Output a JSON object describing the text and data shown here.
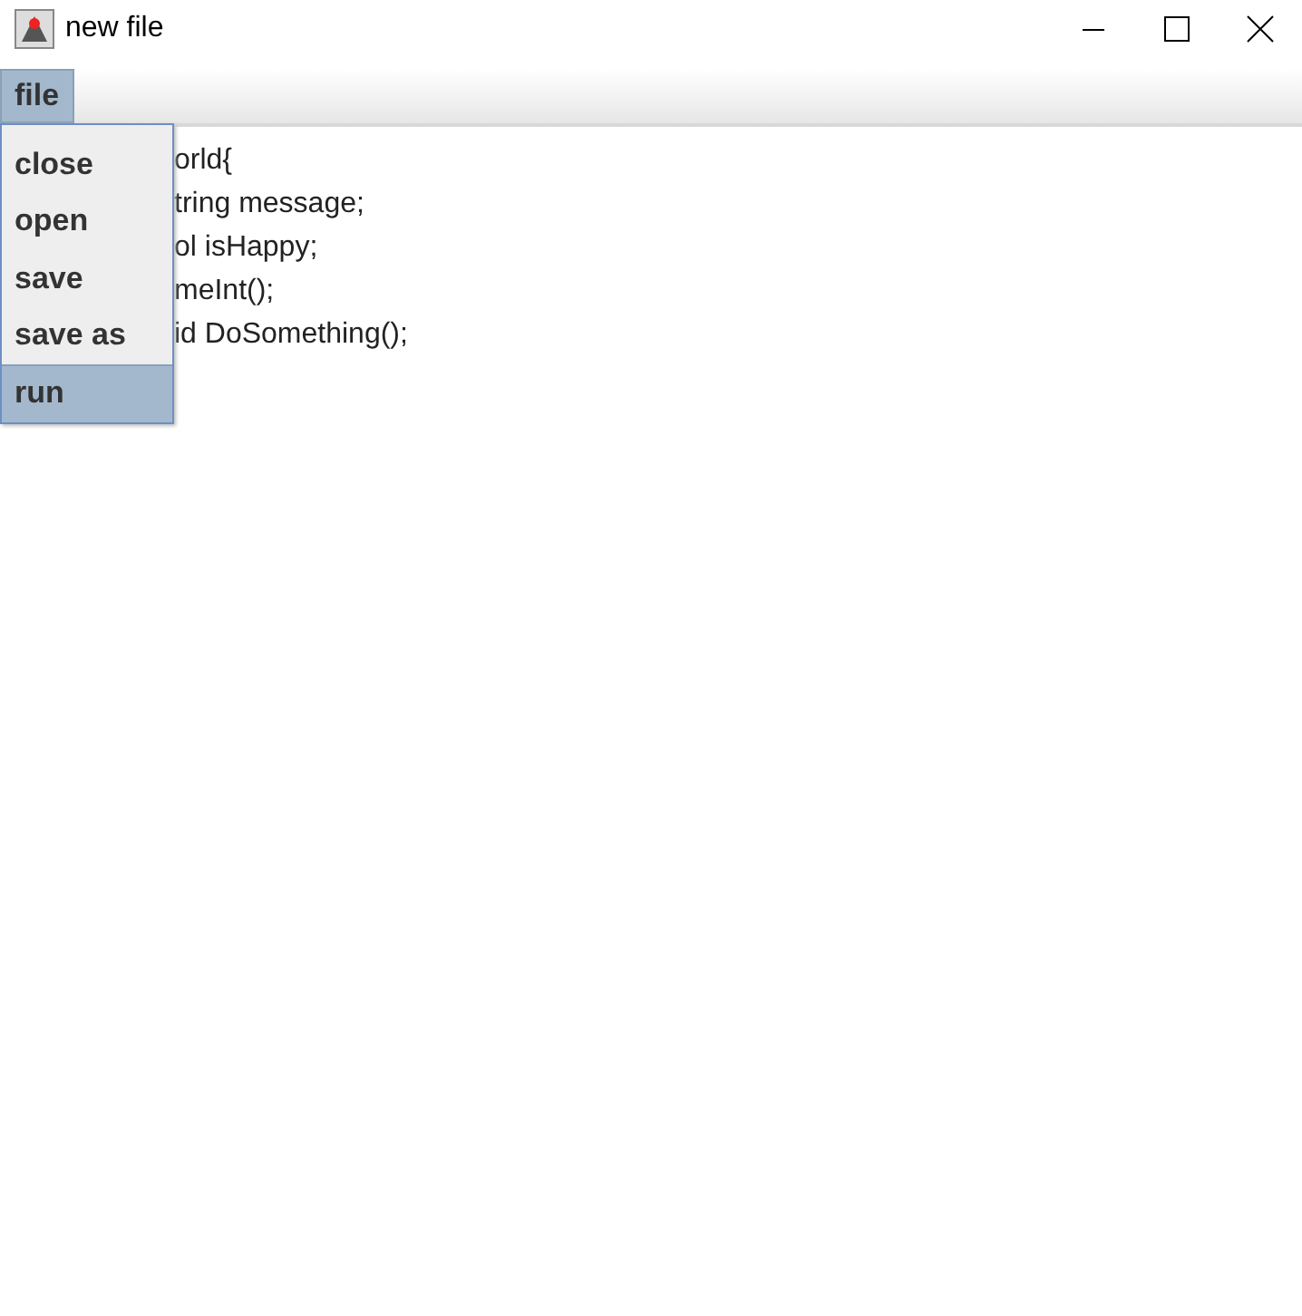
{
  "window": {
    "title": "new file"
  },
  "menu_bar": [
    {
      "label": "file",
      "selected": true
    }
  ],
  "dropdown": {
    "items": [
      {
        "label": "close",
        "selected": false
      },
      {
        "label": "open",
        "selected": false
      },
      {
        "label": "save",
        "selected": false
      },
      {
        "label": "save as",
        "selected": false
      },
      {
        "label": "run",
        "selected": true
      }
    ]
  },
  "editor": {
    "lines": [
      "orld{",
      "tring message;",
      "ol isHappy;",
      "meInt();",
      "id DoSomething();"
    ]
  }
}
